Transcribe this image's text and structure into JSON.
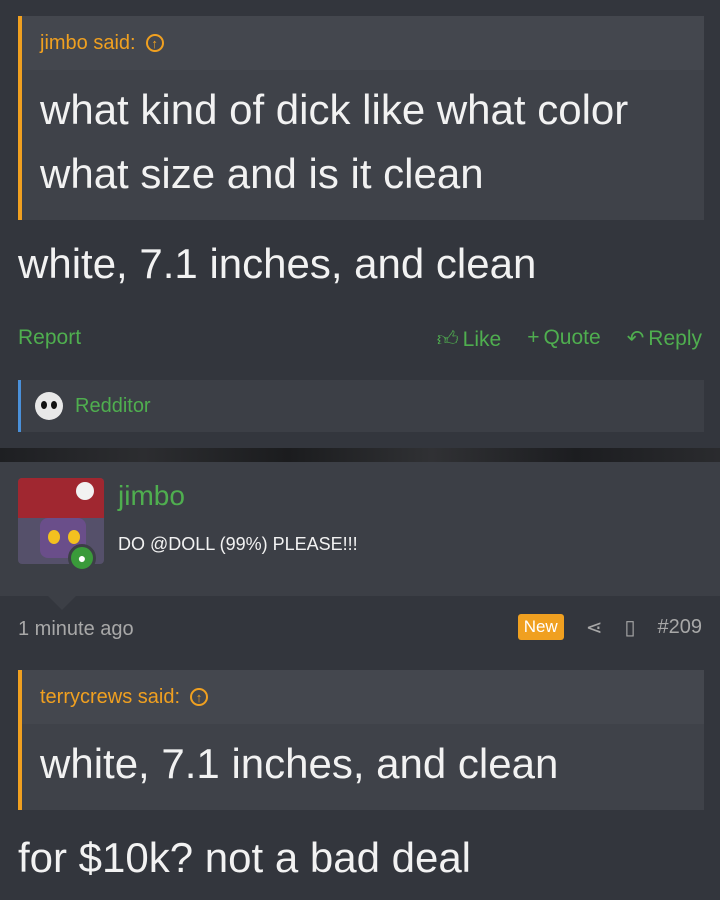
{
  "quote1": {
    "author_said": "jimbo said:",
    "text": "what kind of dick like what color what size and is it clean"
  },
  "post1": {
    "text": "white, 7.1 inches, and clean"
  },
  "actions": {
    "report": "Report",
    "like": "Like",
    "quote": "Quote",
    "reply": "Reply"
  },
  "signature": {
    "label": "Redditor"
  },
  "message": {
    "username": "jimbo",
    "text": "DO @DOLL (99%) PLEASE!!!"
  },
  "post_meta": {
    "time": "1 minute ago",
    "badge": "New",
    "post_number": "#209"
  },
  "quote2": {
    "author_said": "terrycrews said:",
    "text": "white, 7.1 inches, and clean"
  },
  "post2": {
    "text": "for $10k? not a bad deal"
  },
  "colors": {
    "accent_orange": "#f0a020",
    "accent_green": "#4fae4f",
    "background": "#33363d"
  }
}
